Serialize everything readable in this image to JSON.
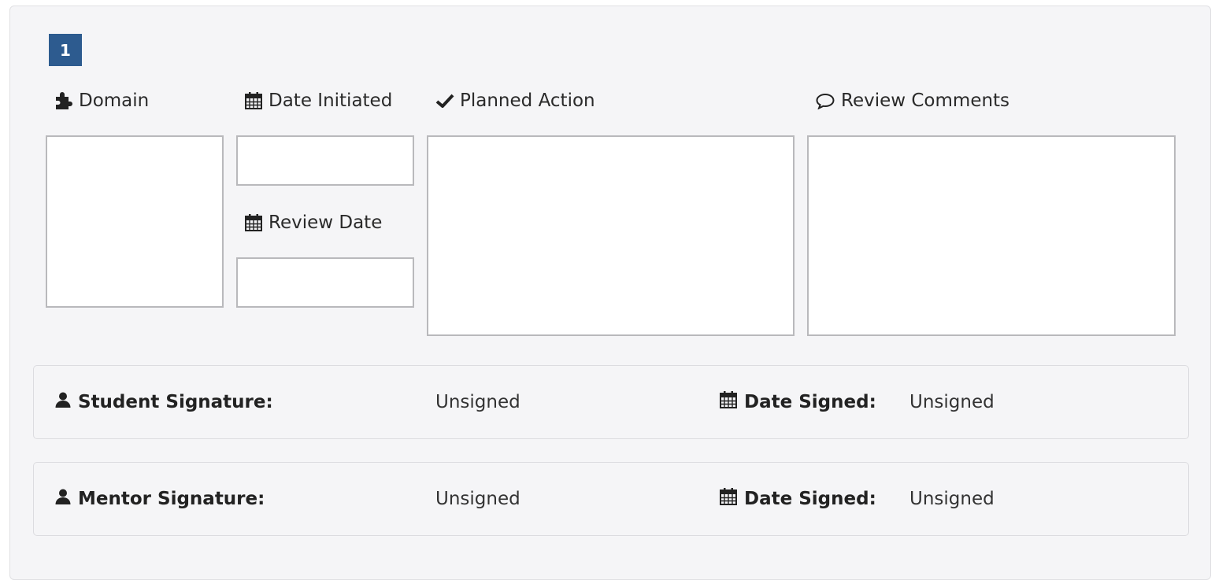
{
  "item": {
    "number": "1"
  },
  "fields": {
    "domain_label": "Domain",
    "date_initiated_label": "Date Initiated",
    "review_date_label": "Review Date",
    "planned_action_label": "Planned Action",
    "review_comments_label": "Review Comments"
  },
  "signatures": [
    {
      "label": "Student Signature:",
      "value": "Unsigned",
      "date_label": "Date Signed:",
      "date_value": "Unsigned"
    },
    {
      "label": "Mentor Signature:",
      "value": "Unsigned",
      "date_label": "Date Signed:",
      "date_value": "Unsigned"
    }
  ],
  "icons": {
    "domain": "puzzle-icon",
    "date": "calendar-icon",
    "planned": "check-icon",
    "comments": "speech-bubble-icon",
    "person": "user-icon"
  },
  "colors": {
    "badge": "#2d5b8f",
    "card_bg": "#f5f5f7"
  }
}
